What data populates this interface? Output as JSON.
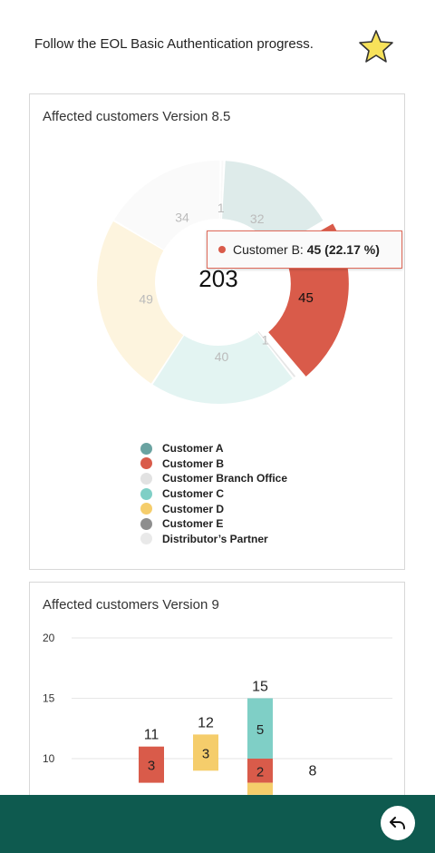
{
  "header": {
    "text": "Follow the EOL Basic Authentication progress.",
    "favorite_icon": "star-icon"
  },
  "card1": {
    "title": "Affected customers Version 8.5",
    "chart_data": {
      "type": "pie",
      "title": "Affected customers Version 8.5",
      "center_total": "203",
      "categories": [
        "Customer A",
        "Customer B",
        "Customer Branch Office",
        "Customer C",
        "Customer D",
        "Customer E",
        "Distributor's Partner"
      ],
      "values": [
        32,
        45,
        1,
        40,
        49,
        1,
        34
      ],
      "colors": [
        "#6aa3a1",
        "#d95b4a",
        "#e2e2e2",
        "#7fcfc6",
        "#f5cd6b",
        "#8e8e8e",
        "#e9e9e9"
      ],
      "highlighted": "Customer B",
      "slice_labels": [
        "32",
        "45",
        "1",
        "40",
        "49",
        "1",
        "34"
      ]
    },
    "tooltip": {
      "label": "Customer B: ",
      "value": "45 (22.17 %)"
    },
    "legend": [
      {
        "label": "Customer A",
        "color": "#6aa3a1"
      },
      {
        "label": "Customer B",
        "color": "#d95b4a"
      },
      {
        "label": "Customer Branch Office",
        "color": "#e2e2e2"
      },
      {
        "label": "Customer C",
        "color": "#7fcfc6"
      },
      {
        "label": "Customer D",
        "color": "#f5cd6b"
      },
      {
        "label": "Customer E",
        "color": "#8e8e8e"
      },
      {
        "label": "Distributor’s Partner",
        "color": "#e9e9e9"
      }
    ]
  },
  "card2": {
    "title": "Affected customers Version 9",
    "chart_data": {
      "type": "bar",
      "title": "Affected customers Version 9",
      "y_ticks": [
        "20",
        "15",
        "10"
      ],
      "ylim": [
        0,
        20
      ],
      "stacked": true,
      "bars": [
        {
          "total": "11",
          "segments": [
            {
              "value": 3,
              "label": "3",
              "color": "#d95b4a"
            }
          ]
        },
        {
          "total": "12",
          "segments": [
            {
              "value": 3,
              "label": "3",
              "color": "#f5cd6b"
            }
          ]
        },
        {
          "total": "15",
          "segments": [
            {
              "value": 5,
              "label": "5",
              "color": "#7fcfc6"
            },
            {
              "value": 2,
              "label": "2",
              "color": "#d95b4a"
            },
            {
              "value": 1,
              "label": "",
              "color": "#f5cd6b"
            }
          ]
        },
        {
          "total": "8",
          "segments": []
        }
      ]
    }
  },
  "footer": {
    "back_icon": "back-arrow-icon"
  }
}
